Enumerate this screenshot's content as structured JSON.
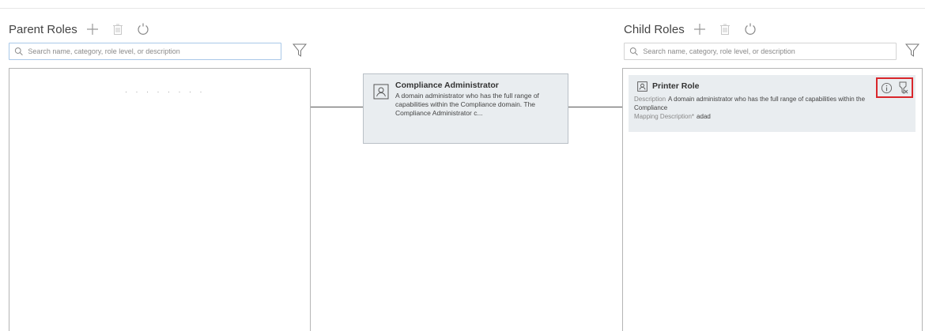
{
  "parent": {
    "title": "Parent Roles",
    "search_placeholder": "Search name, category, role level, or description",
    "loading_dots": "· · · · · · · ·",
    "icons": [
      "add-icon",
      "delete-icon",
      "refresh-icon",
      "filter-icon"
    ]
  },
  "center": {
    "title": "Compliance Administrator",
    "description": "A domain administrator who has the full range of capabilities within the Compliance domain. The Compliance Administrator c..."
  },
  "child": {
    "title": "Child Roles",
    "search_placeholder": "Search name, category, role level, or description",
    "card": {
      "name": "Printer Role",
      "description_label": "Description",
      "description": "A domain administrator who has the full range of capabilities within the Compliance",
      "mapping_label": "Mapping Description*",
      "mapping_value": "adad"
    }
  },
  "colors": {
    "accent_border": "#a9c8e8",
    "card_bg": "#e9edf0",
    "highlight": "#d9262b"
  }
}
